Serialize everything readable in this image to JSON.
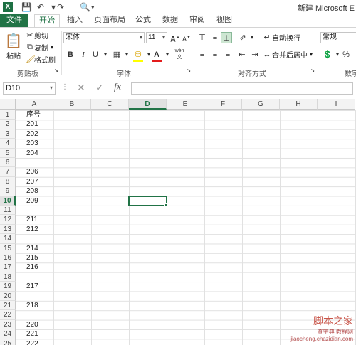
{
  "window": {
    "app_icon": "X",
    "title": "新建 Microsoft E"
  },
  "quick_access": {
    "save_icon": "save-icon",
    "undo_icon": "undo-icon",
    "redo_icon": "redo-icon",
    "preview_icon": "print-preview-icon"
  },
  "tabs": [
    "文件",
    "开始",
    "插入",
    "页面布局",
    "公式",
    "数据",
    "审阅",
    "视图"
  ],
  "ribbon": {
    "clipboard": {
      "paste": "粘贴",
      "cut": "剪切",
      "copy": "复制",
      "format_painter": "格式刷",
      "label": "剪贴板"
    },
    "font": {
      "name": "宋体",
      "size": "11",
      "label": "字体",
      "bold": "B",
      "italic": "I",
      "underline": "U",
      "grow": "A",
      "shrink": "A",
      "wen": "wén"
    },
    "alignment": {
      "wrap_text": "自动换行",
      "merge_center": "合并后居中",
      "label": "对齐方式"
    },
    "number": {
      "format": "常规",
      "percent": "%",
      "label": "数字"
    }
  },
  "formula_bar": {
    "name_box": "D10",
    "fx": "fx",
    "value": ""
  },
  "sheet": {
    "columns": [
      "A",
      "B",
      "C",
      "D",
      "E",
      "F",
      "G",
      "H",
      "I"
    ],
    "selected_column": "D",
    "selected_row": 10,
    "row_numbers": [
      "1",
      "2",
      "3",
      "4",
      "5",
      "6",
      "7",
      "8",
      "9",
      "10",
      "11",
      "12",
      "13",
      "14",
      "15",
      "16",
      "17",
      "18",
      "19",
      "20",
      "21",
      "22",
      "23",
      "24",
      "25"
    ],
    "column_a": [
      "序号",
      "201",
      "202",
      "203",
      "204",
      "",
      "206",
      "207",
      "208",
      "209",
      "",
      "211",
      "212",
      "",
      "214",
      "215",
      "216",
      "",
      "217",
      "",
      "218",
      "",
      "220",
      "221",
      "222"
    ]
  },
  "watermark": {
    "main": "脚本之家",
    "sub": "jiaocheng.chazidian.com",
    "extra": "查字典 教程网"
  },
  "colors": {
    "accent": "#217346"
  }
}
